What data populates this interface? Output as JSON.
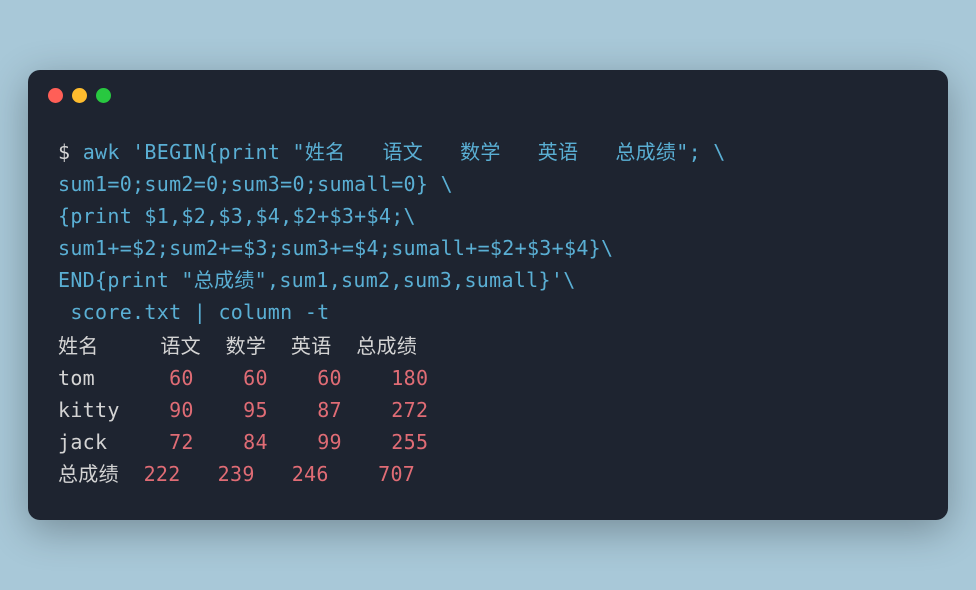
{
  "titlebar": {
    "buttons": [
      "close",
      "minimize",
      "maximize"
    ]
  },
  "command": {
    "line1_prompt": "$ ",
    "line1_cmd": "awk ",
    "line1_arg": "'BEGIN{print \"姓名   语文   数学   英语   总成绩\"; \\",
    "line2": "sum1=0;sum2=0;sum3=0;sumall=0} \\",
    "line3": "{print $1,$2,$3,$4,$2+$3+$4;\\",
    "line4": "sum1+=$2;sum2+=$3;sum3+=$4;sumall+=$2+$3+$4}\\",
    "line5": "END{print \"总成绩\",sum1,sum2,sum3,sumall}'",
    "line5_cont": "\\",
    "line6_pre": " score.txt | ",
    "line6_cmd": "column ",
    "line6_flag": "-t"
  },
  "output": {
    "header": {
      "col1": "姓名",
      "col2": "语文",
      "col3": "数学",
      "col4": "英语",
      "col5": "总成绩"
    },
    "rows": [
      {
        "name": "tom",
        "c1": "60",
        "c2": "60",
        "c3": "60",
        "c4": "180"
      },
      {
        "name": "kitty",
        "c1": "90",
        "c2": "95",
        "c3": "87",
        "c4": "272"
      },
      {
        "name": "jack",
        "c1": "72",
        "c2": "84",
        "c3": "99",
        "c4": "255"
      },
      {
        "name": "总成绩",
        "c1": "222",
        "c2": "239",
        "c3": "246",
        "c4": "707"
      }
    ]
  }
}
